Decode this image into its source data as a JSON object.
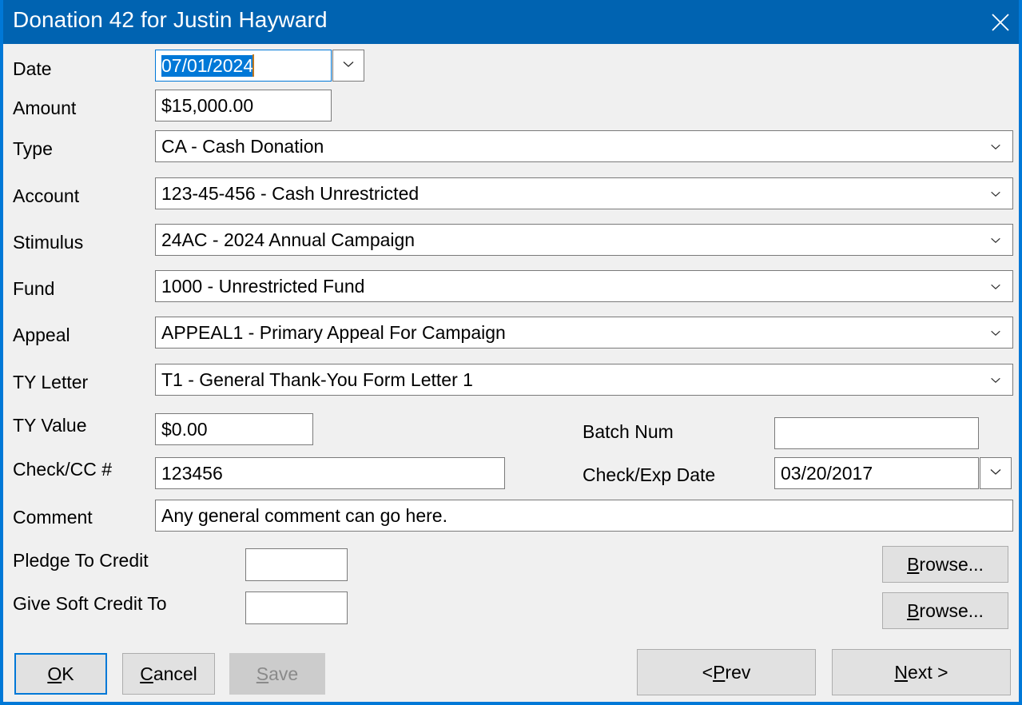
{
  "window": {
    "title": "Donation 42 for Justin Hayward",
    "close_icon": "close-icon",
    "accent_color": "#0063b1",
    "frame_color": "#0078d7",
    "background_color": "#f0f0f0"
  },
  "fields": {
    "date": {
      "label": "Date",
      "value": "07/01/2024",
      "selected": true,
      "has_dropdown": true
    },
    "amount": {
      "label": "Amount",
      "value": "$15,000.00"
    },
    "type": {
      "label": "Type",
      "value": "CA - Cash Donation"
    },
    "account": {
      "label": "Account",
      "value": "123-45-456 - Cash Unrestricted"
    },
    "stimulus": {
      "label": "Stimulus",
      "value": "24AC - 2024 Annual Campaign"
    },
    "fund": {
      "label": "Fund",
      "value": "1000 - Unrestricted Fund"
    },
    "appeal": {
      "label": "Appeal",
      "value": "APPEAL1 - Primary Appeal For Campaign"
    },
    "ty_letter": {
      "label": "TY Letter",
      "value": "T1 - General Thank-You Form Letter 1"
    },
    "ty_value": {
      "label": "TY Value",
      "value": "$0.00"
    },
    "batch_num": {
      "label": "Batch Num",
      "value": ""
    },
    "check_cc": {
      "label": "Check/CC #",
      "value": "123456"
    },
    "check_exp_date": {
      "label": "Check/Exp Date",
      "value": "03/20/2017"
    },
    "comment": {
      "label": "Comment",
      "value": "Any general comment can go here."
    },
    "pledge_to_credit": {
      "label": "Pledge To Credit",
      "value": ""
    },
    "give_soft_credit_to": {
      "label": "Give Soft Credit To",
      "value": ""
    }
  },
  "buttons": {
    "browse_pledge": {
      "accel": "B",
      "rest": "rowse..."
    },
    "browse_soft": {
      "accel": "B",
      "rest": "rowse..."
    },
    "ok": {
      "accel": "O",
      "rest": "K"
    },
    "cancel": {
      "accel": "C",
      "rest": "ancel"
    },
    "save": {
      "accel": "S",
      "rest": "ave",
      "enabled": false
    },
    "prev": {
      "pre": "< ",
      "accel": "P",
      "rest": "rev"
    },
    "next": {
      "pre": "",
      "accel": "N",
      "rest": "ext >"
    }
  },
  "icons": {
    "chevron_down": "chevron-down-icon"
  }
}
